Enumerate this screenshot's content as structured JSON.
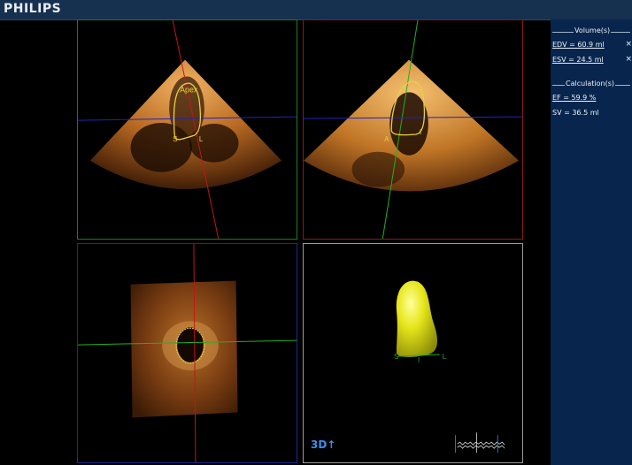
{
  "header": {
    "brand": "PHILIPS"
  },
  "views": {
    "top_left": {
      "label": "Apex",
      "markers": [
        "S",
        "L"
      ]
    },
    "top_right": {
      "markers": [
        "A",
        "I"
      ]
    },
    "volume_3d": {
      "markers": [
        "S",
        "I",
        "L"
      ],
      "mode_label": "3D↑"
    }
  },
  "sidebar": {
    "volumes": {
      "title": "Volume(s)",
      "items": [
        {
          "label": "EDV = 60.9 ml",
          "remove": "×"
        },
        {
          "label": "ESV = 24.5 ml",
          "remove": "×"
        }
      ]
    },
    "calculations": {
      "title": "Calculation(s)",
      "items": [
        {
          "label": "EF = 59.9 %"
        },
        {
          "label": "SV = 36.5 ml"
        }
      ]
    }
  },
  "colors": {
    "header_bg": "#16304f",
    "sidebar_bg": "#07254d",
    "lv_contour": "#e8d23a",
    "lv_model": "#e6e61a",
    "axis_green": "#22b022",
    "axis_red": "#c01818",
    "axis_blue": "#2222c0",
    "mode_label": "#3c8ff0"
  }
}
